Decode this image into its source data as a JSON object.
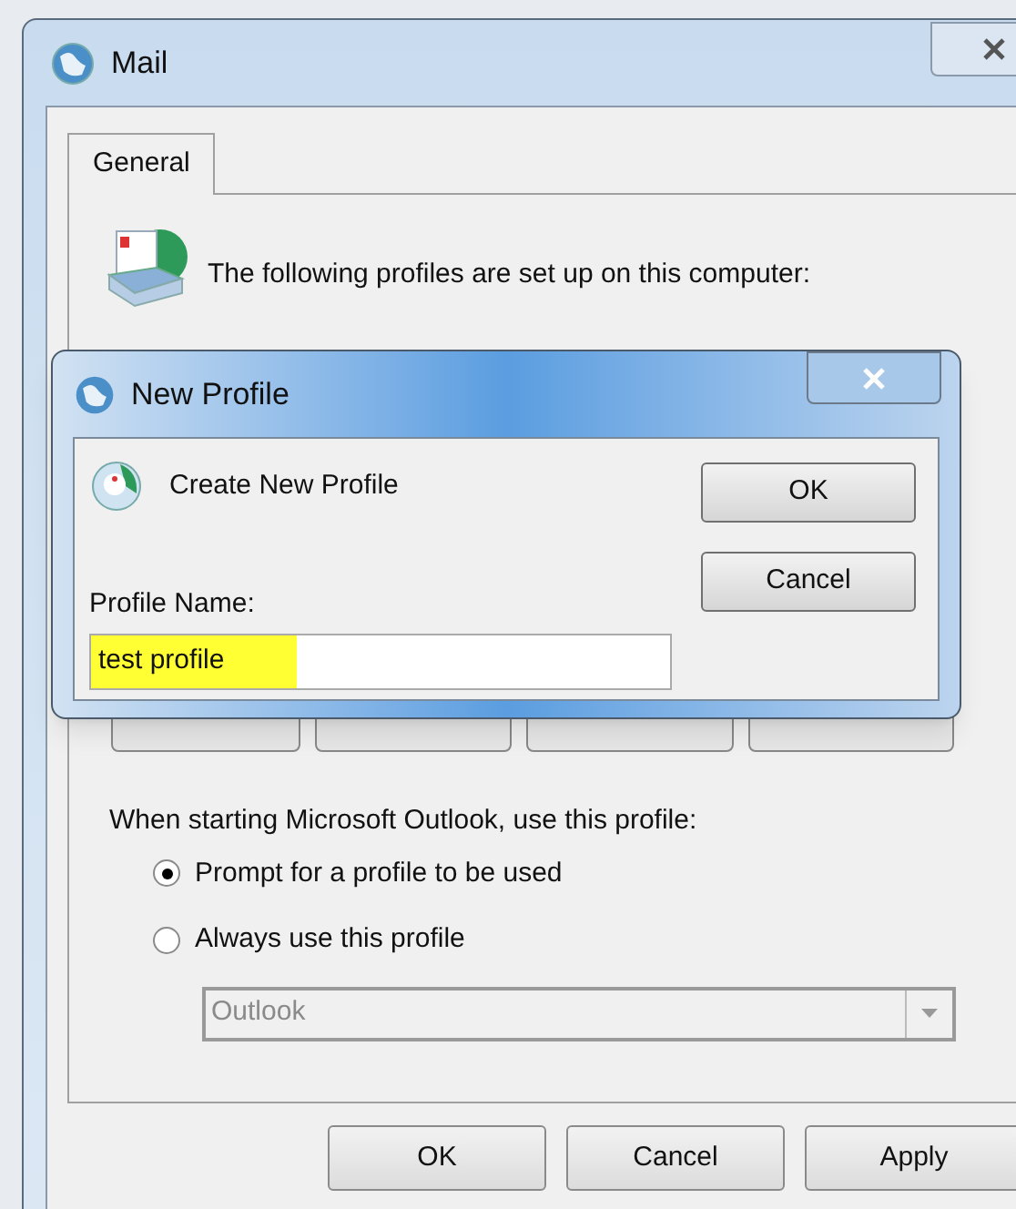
{
  "window": {
    "title": "Mail",
    "tabs": [
      {
        "label": "General",
        "selected": true
      }
    ],
    "intro": "The following profiles are set up on this computer:",
    "startup_label": "When starting Microsoft Outlook, use this profile:",
    "startup_options": [
      {
        "label": "Prompt for a profile to be used",
        "selected": true
      },
      {
        "label": "Always use this profile",
        "selected": false
      }
    ],
    "profile_dropdown": {
      "value": "Outlook",
      "disabled": true
    },
    "buttons": [
      "OK",
      "Cancel",
      "Apply"
    ]
  },
  "dialog": {
    "title": "New Profile",
    "heading": "Create New Profile",
    "field_label": "Profile Name:",
    "field_value": "test profile",
    "highlighted": true,
    "buttons": [
      "OK",
      "Cancel"
    ]
  }
}
